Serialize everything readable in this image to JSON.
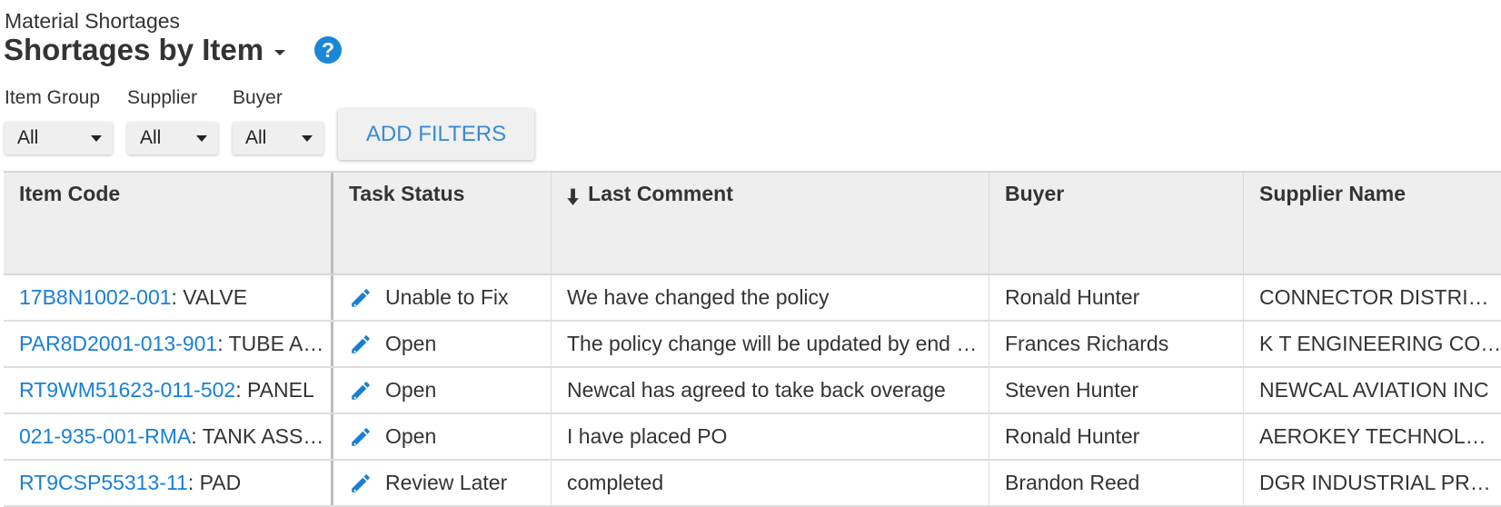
{
  "page": {
    "subtitle": "Material Shortages",
    "title": "Shortages by Item",
    "help_icon": "?"
  },
  "filters": [
    {
      "label": "Item Group",
      "value": "All"
    },
    {
      "label": "Supplier",
      "value": "All"
    },
    {
      "label": "Buyer",
      "value": "All"
    }
  ],
  "add_filters_label": "ADD FILTERS",
  "table": {
    "columns": [
      "Item Code",
      "Task Status",
      "Last Comment",
      "Buyer",
      "Supplier Name"
    ],
    "sorted_column": "Last Comment",
    "sort_direction": "descending",
    "rows": [
      {
        "code": "17B8N1002-001",
        "desc": ": VALVE",
        "status": "Unable to Fix",
        "comment": "We have changed the policy",
        "buyer": "Ronald Hunter",
        "supplier": "CONNECTOR DISTRIBUTORS"
      },
      {
        "code": "PAR8D2001-013-901",
        "desc": ": TUBE ASSEMBLY",
        "status": "Open",
        "comment": "The policy change will be updated by end of week",
        "buyer": "Frances Richards",
        "supplier": "K T ENGINEERING CORP"
      },
      {
        "code": "RT9WM51623-011-502",
        "desc": ": PANEL",
        "status": "Open",
        "comment": "Newcal has agreed to take back overage",
        "buyer": "Steven Hunter",
        "supplier": "NEWCAL AVIATION INC"
      },
      {
        "code": "021-935-001-RMA",
        "desc": ": TANK ASSEMBLY",
        "status": "Open",
        "comment": "I have placed PO",
        "buyer": "Ronald Hunter",
        "supplier": "AEROKEY TECHNOLOGIES"
      },
      {
        "code": "RT9CSP55313-11",
        "desc": ": PAD",
        "status": "Review Later",
        "comment": "completed",
        "buyer": "Brandon Reed",
        "supplier": "DGR INDUSTRIAL PRODUCTS"
      }
    ]
  },
  "colors": {
    "link": "#1a7fd4",
    "accent": "#1a87d8",
    "button_text": "#3a8ad3"
  },
  "icons": {
    "status_edit": "pencil-icon",
    "sort": "arrow-down-icon",
    "help": "help-icon",
    "dropdown": "chevron-down-icon"
  }
}
